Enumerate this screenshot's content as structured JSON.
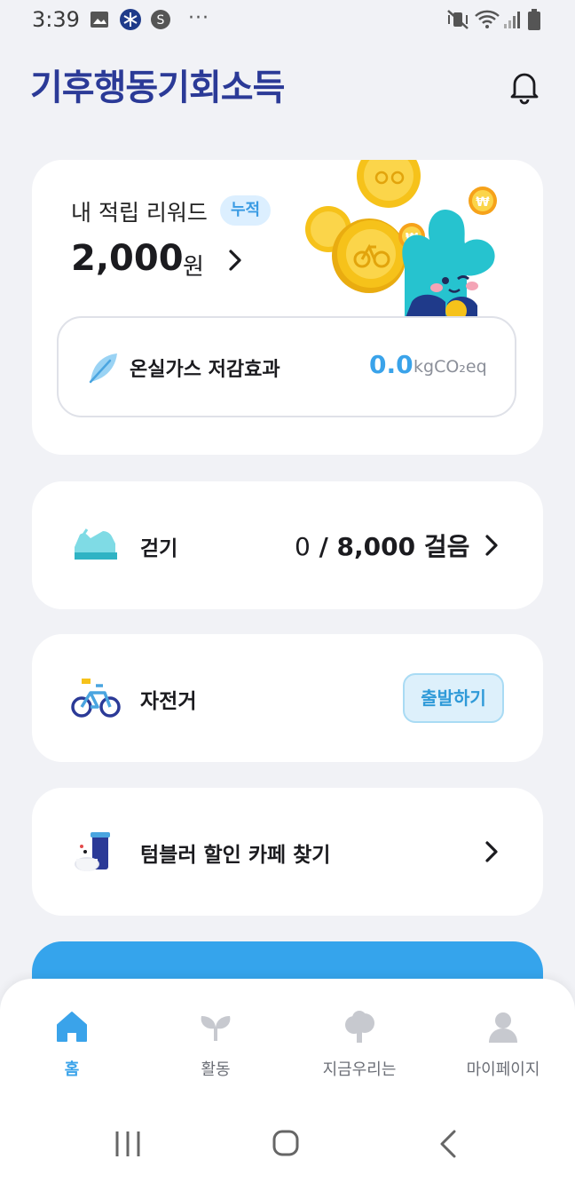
{
  "status_bar": {
    "time": "3:39",
    "icons": [
      "image-icon",
      "snowflake-app-icon",
      "s-app-icon",
      "more-dots-icon",
      "mute-vibrate-icon",
      "wifi-icon",
      "signal-icon",
      "battery-icon"
    ],
    "dots": "···"
  },
  "header": {
    "logo_text": "기후행동기회소득",
    "icon": "bell-icon"
  },
  "reward": {
    "label": "내 적립 리워드",
    "badge": "누적",
    "amount": "2,000",
    "unit": "원",
    "ghg_label": "온실가스 저감효과",
    "ghg_value": "0.0",
    "ghg_unit": "kgCO₂eq"
  },
  "walk": {
    "title": "걷기",
    "current": "0",
    "goal": " / 8,000 걸음"
  },
  "bike": {
    "title": "자전거",
    "button": "출발하기"
  },
  "tumbler": {
    "title": "텀블러 할인 카페 찾기"
  },
  "nav": {
    "items": [
      {
        "label": "홈",
        "icon": "home-icon",
        "active": true
      },
      {
        "label": "활동",
        "icon": "sprout-icon",
        "active": false
      },
      {
        "label": "지금우리는",
        "icon": "tree-icon",
        "active": false
      },
      {
        "label": "마이페이지",
        "icon": "person-icon",
        "active": false
      }
    ]
  },
  "colors": {
    "accent": "#3aa3ea",
    "logo": "#2b3a97",
    "background": "#f1f2f6",
    "blue_card": "#35a4ec"
  }
}
